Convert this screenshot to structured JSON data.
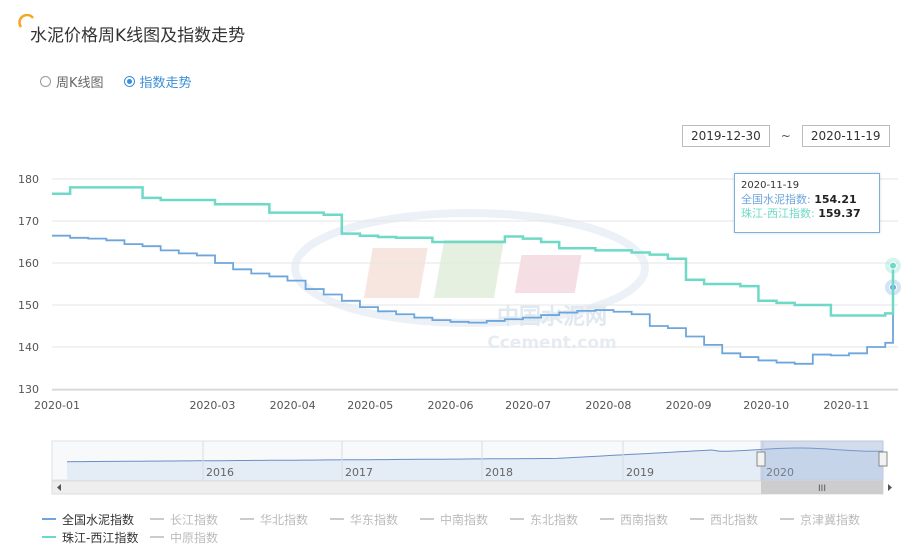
{
  "page": {
    "title": "水泥价格周K线图及指数走势",
    "tabs": [
      {
        "label": "周K线图",
        "selected": false
      },
      {
        "label": "指数走势",
        "selected": true
      }
    ],
    "date_range": {
      "start": "2019-12-30",
      "separator": "~",
      "end": "2020-11-19"
    },
    "watermark": {
      "cn": "中国水泥网",
      "en": "Ccement.com"
    },
    "tooltip": {
      "date": "2020-11-19",
      "rows": [
        {
          "label": "全国水泥指数:",
          "value": "154.21",
          "color": "#6ea6dc"
        },
        {
          "label": "珠江-西江指数:",
          "value": "159.37",
          "color": "#6fd9c7"
        }
      ]
    },
    "legend": [
      {
        "label": "全国水泥指数",
        "active": true,
        "color": "#6ea6dc"
      },
      {
        "label": "长江指数",
        "active": false
      },
      {
        "label": "华北指数",
        "active": false
      },
      {
        "label": "华东指数",
        "active": false
      },
      {
        "label": "中南指数",
        "active": false
      },
      {
        "label": "东北指数",
        "active": false
      },
      {
        "label": "西南指数",
        "active": false
      },
      {
        "label": "西北指数",
        "active": false
      },
      {
        "label": "京津冀指数",
        "active": false
      },
      {
        "label": "珠江-西江指数",
        "active": true,
        "color": "#6fd9c7"
      },
      {
        "label": "中原指数",
        "active": false
      }
    ],
    "navigator": {
      "year_labels": [
        "2016",
        "2017",
        "2018",
        "2019",
        "2020"
      ],
      "scroll_grip": "III"
    }
  },
  "chart_data": {
    "type": "line",
    "ylim": [
      130,
      185
    ],
    "yticks": [
      130,
      140,
      150,
      160,
      170,
      180
    ],
    "x_range": [
      "2019-12-30",
      "2020-11-19"
    ],
    "xticks": [
      "2020-01",
      "2020-03",
      "2020-04",
      "2020-05",
      "2020-06",
      "2020-07",
      "2020-08",
      "2020-09",
      "2020-10",
      "2020-11"
    ],
    "series": [
      {
        "name": "全国水泥指数",
        "color": "#6ea6dc",
        "points": [
          [
            "2019-12-30",
            166.5
          ],
          [
            "2020-01-06",
            166.0
          ],
          [
            "2020-01-13",
            165.8
          ],
          [
            "2020-01-20",
            165.4
          ],
          [
            "2020-01-27",
            164.5
          ],
          [
            "2020-02-03",
            164.0
          ],
          [
            "2020-02-10",
            163.0
          ],
          [
            "2020-02-17",
            162.3
          ],
          [
            "2020-02-24",
            161.8
          ],
          [
            "2020-03-02",
            160.0
          ],
          [
            "2020-03-09",
            158.5
          ],
          [
            "2020-03-16",
            157.5
          ],
          [
            "2020-03-23",
            156.8
          ],
          [
            "2020-03-30",
            155.8
          ],
          [
            "2020-04-06",
            153.8
          ],
          [
            "2020-04-13",
            152.5
          ],
          [
            "2020-04-20",
            151.0
          ],
          [
            "2020-04-27",
            149.5
          ],
          [
            "2020-05-04",
            148.5
          ],
          [
            "2020-05-11",
            147.8
          ],
          [
            "2020-05-18",
            147.0
          ],
          [
            "2020-05-25",
            146.4
          ],
          [
            "2020-06-01",
            146.0
          ],
          [
            "2020-06-08",
            145.8
          ],
          [
            "2020-06-15",
            146.2
          ],
          [
            "2020-06-22",
            146.6
          ],
          [
            "2020-06-29",
            147.0
          ],
          [
            "2020-07-06",
            147.6
          ],
          [
            "2020-07-13",
            148.2
          ],
          [
            "2020-07-20",
            148.6
          ],
          [
            "2020-07-27",
            148.8
          ],
          [
            "2020-08-03",
            148.4
          ],
          [
            "2020-08-10",
            147.8
          ],
          [
            "2020-08-17",
            145.0
          ],
          [
            "2020-08-24",
            144.5
          ],
          [
            "2020-08-31",
            142.5
          ],
          [
            "2020-09-07",
            140.5
          ],
          [
            "2020-09-14",
            138.5
          ],
          [
            "2020-09-21",
            137.6
          ],
          [
            "2020-09-28",
            136.8
          ],
          [
            "2020-10-05",
            136.3
          ],
          [
            "2020-10-12",
            136.0
          ],
          [
            "2020-10-19",
            138.2
          ],
          [
            "2020-10-26",
            138.0
          ],
          [
            "2020-11-02",
            138.5
          ],
          [
            "2020-11-09",
            140.0
          ],
          [
            "2020-11-16",
            141.0
          ],
          [
            "2020-11-19",
            154.21
          ]
        ]
      },
      {
        "name": "珠江-西江指数",
        "color": "#6fd9c7",
        "points": [
          [
            "2019-12-30",
            176.5
          ],
          [
            "2020-01-06",
            178.0
          ],
          [
            "2020-01-13",
            178.0
          ],
          [
            "2020-01-20",
            178.0
          ],
          [
            "2020-01-27",
            178.0
          ],
          [
            "2020-02-03",
            175.5
          ],
          [
            "2020-02-10",
            175.0
          ],
          [
            "2020-02-17",
            175.0
          ],
          [
            "2020-02-24",
            175.0
          ],
          [
            "2020-03-02",
            174.0
          ],
          [
            "2020-03-09",
            174.0
          ],
          [
            "2020-03-16",
            174.0
          ],
          [
            "2020-03-23",
            172.0
          ],
          [
            "2020-03-30",
            172.0
          ],
          [
            "2020-04-06",
            172.0
          ],
          [
            "2020-04-13",
            171.5
          ],
          [
            "2020-04-20",
            167.0
          ],
          [
            "2020-04-27",
            166.5
          ],
          [
            "2020-05-04",
            166.2
          ],
          [
            "2020-05-11",
            166.0
          ],
          [
            "2020-05-18",
            166.0
          ],
          [
            "2020-05-25",
            165.0
          ],
          [
            "2020-06-01",
            165.0
          ],
          [
            "2020-06-08",
            165.0
          ],
          [
            "2020-06-15",
            165.0
          ],
          [
            "2020-06-22",
            166.3
          ],
          [
            "2020-06-29",
            165.8
          ],
          [
            "2020-07-06",
            165.0
          ],
          [
            "2020-07-13",
            163.5
          ],
          [
            "2020-07-20",
            163.5
          ],
          [
            "2020-07-27",
            163.0
          ],
          [
            "2020-08-03",
            163.0
          ],
          [
            "2020-08-10",
            162.5
          ],
          [
            "2020-08-17",
            162.0
          ],
          [
            "2020-08-24",
            161.0
          ],
          [
            "2020-08-31",
            156.0
          ],
          [
            "2020-09-07",
            155.0
          ],
          [
            "2020-09-14",
            155.0
          ],
          [
            "2020-09-21",
            154.5
          ],
          [
            "2020-09-28",
            151.0
          ],
          [
            "2020-10-05",
            150.5
          ],
          [
            "2020-10-12",
            150.0
          ],
          [
            "2020-10-19",
            150.0
          ],
          [
            "2020-10-26",
            147.5
          ],
          [
            "2020-11-02",
            147.5
          ],
          [
            "2020-11-09",
            147.5
          ],
          [
            "2020-11-16",
            148.0
          ],
          [
            "2020-11-19",
            159.37
          ]
        ]
      }
    ]
  }
}
